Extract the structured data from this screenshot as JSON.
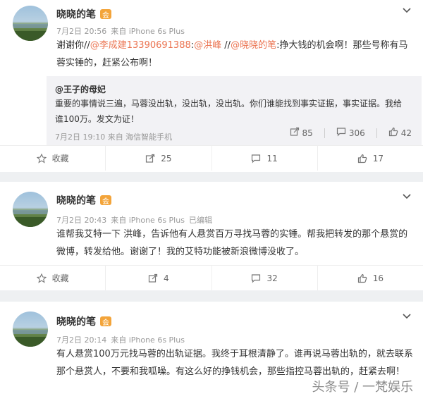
{
  "posts": [
    {
      "author": "晓晓的笔",
      "badge": "会",
      "meta": {
        "date": "7月2日 20:56",
        "source": "来自 iPhone 6s Plus"
      },
      "text_parts": [
        {
          "t": "谢谢你//",
          "m": false
        },
        {
          "t": "@李成建13390691388",
          "m": true
        },
        {
          "t": ":",
          "m": false
        },
        {
          "t": "@洪峰",
          "m": true
        },
        {
          "t": " //",
          "m": false
        },
        {
          "t": "@晓晓的笔",
          "m": true
        },
        {
          "t": ":挣大钱的机会啊！那些号称有马蓉实锤的，赶紧公布啊！",
          "m": false
        }
      ],
      "quote": {
        "author": "@王子的母妃",
        "text": "重要的事情说三遍，马蓉没出轨，没出轨，没出轨。你们谁能找到事实证据，事实证据。我给谁100万。发文为证！",
        "meta": "7月2日 19:10 来自 海信智能手机",
        "reposts": "85",
        "comments": "306",
        "likes": "42"
      },
      "actions": {
        "collect": "收藏",
        "reposts": "25",
        "comments": "11",
        "likes": "17"
      }
    },
    {
      "author": "晓晓的笔",
      "badge": "会",
      "meta": {
        "date": "7月2日 20:43",
        "source": "来自 iPhone 6s Plus",
        "edited": "已编辑"
      },
      "text": "谁帮我艾特一下 洪峰，告诉他有人悬赏百万寻找马蓉的实锤。帮我把转发的那个悬赏的微博，转发给他。谢谢了！我的艾特功能被新浪微博没收了。",
      "actions": {
        "collect": "收藏",
        "reposts": "4",
        "comments": "32",
        "likes": "16"
      }
    },
    {
      "author": "晓晓的笔",
      "badge": "会",
      "meta": {
        "date": "7月2日 20:14",
        "source": "来自 iPhone 6s Plus"
      },
      "text": "有人悬赏100万元找马蓉的出轨证据。我终于耳根清静了。谁再说马蓉出轨的，就去联系那个悬赏人，不要和我呱噪。有这么好的挣钱机会，那些指控马蓉出轨的，赶紧去啊！"
    }
  ],
  "watermark": "头条号 / 一梵娱乐",
  "colors": {
    "mention": "#eb7350",
    "meta": "#999999",
    "badge": "#f3a43a"
  }
}
